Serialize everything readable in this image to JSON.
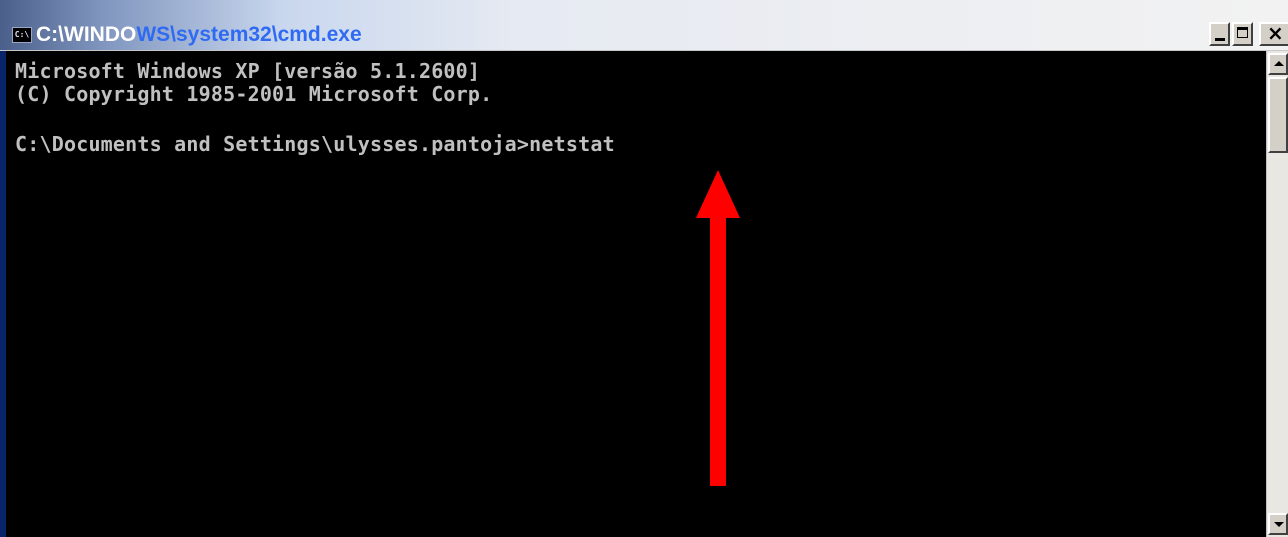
{
  "window": {
    "title_visible": "C:\\WINDO",
    "title_overlay": "WS\\system32\\cmd.exe",
    "icon_glyph": "C:\\",
    "controls": {
      "minimize": "minimize-icon",
      "maximize": "maximize-icon",
      "close": "close-icon"
    }
  },
  "console": {
    "lines": [
      "Microsoft Windows XP [versão 5.1.2600]",
      "(C) Copyright 1985-2001 Microsoft Corp.",
      "C:\\Documents and Settings\\ulysses.pantoja>netstat"
    ],
    "background": "#000000",
    "foreground": "#c0c0c0"
  },
  "annotation": {
    "arrow_color": "#ff0000",
    "icon": "red-up-arrow"
  }
}
